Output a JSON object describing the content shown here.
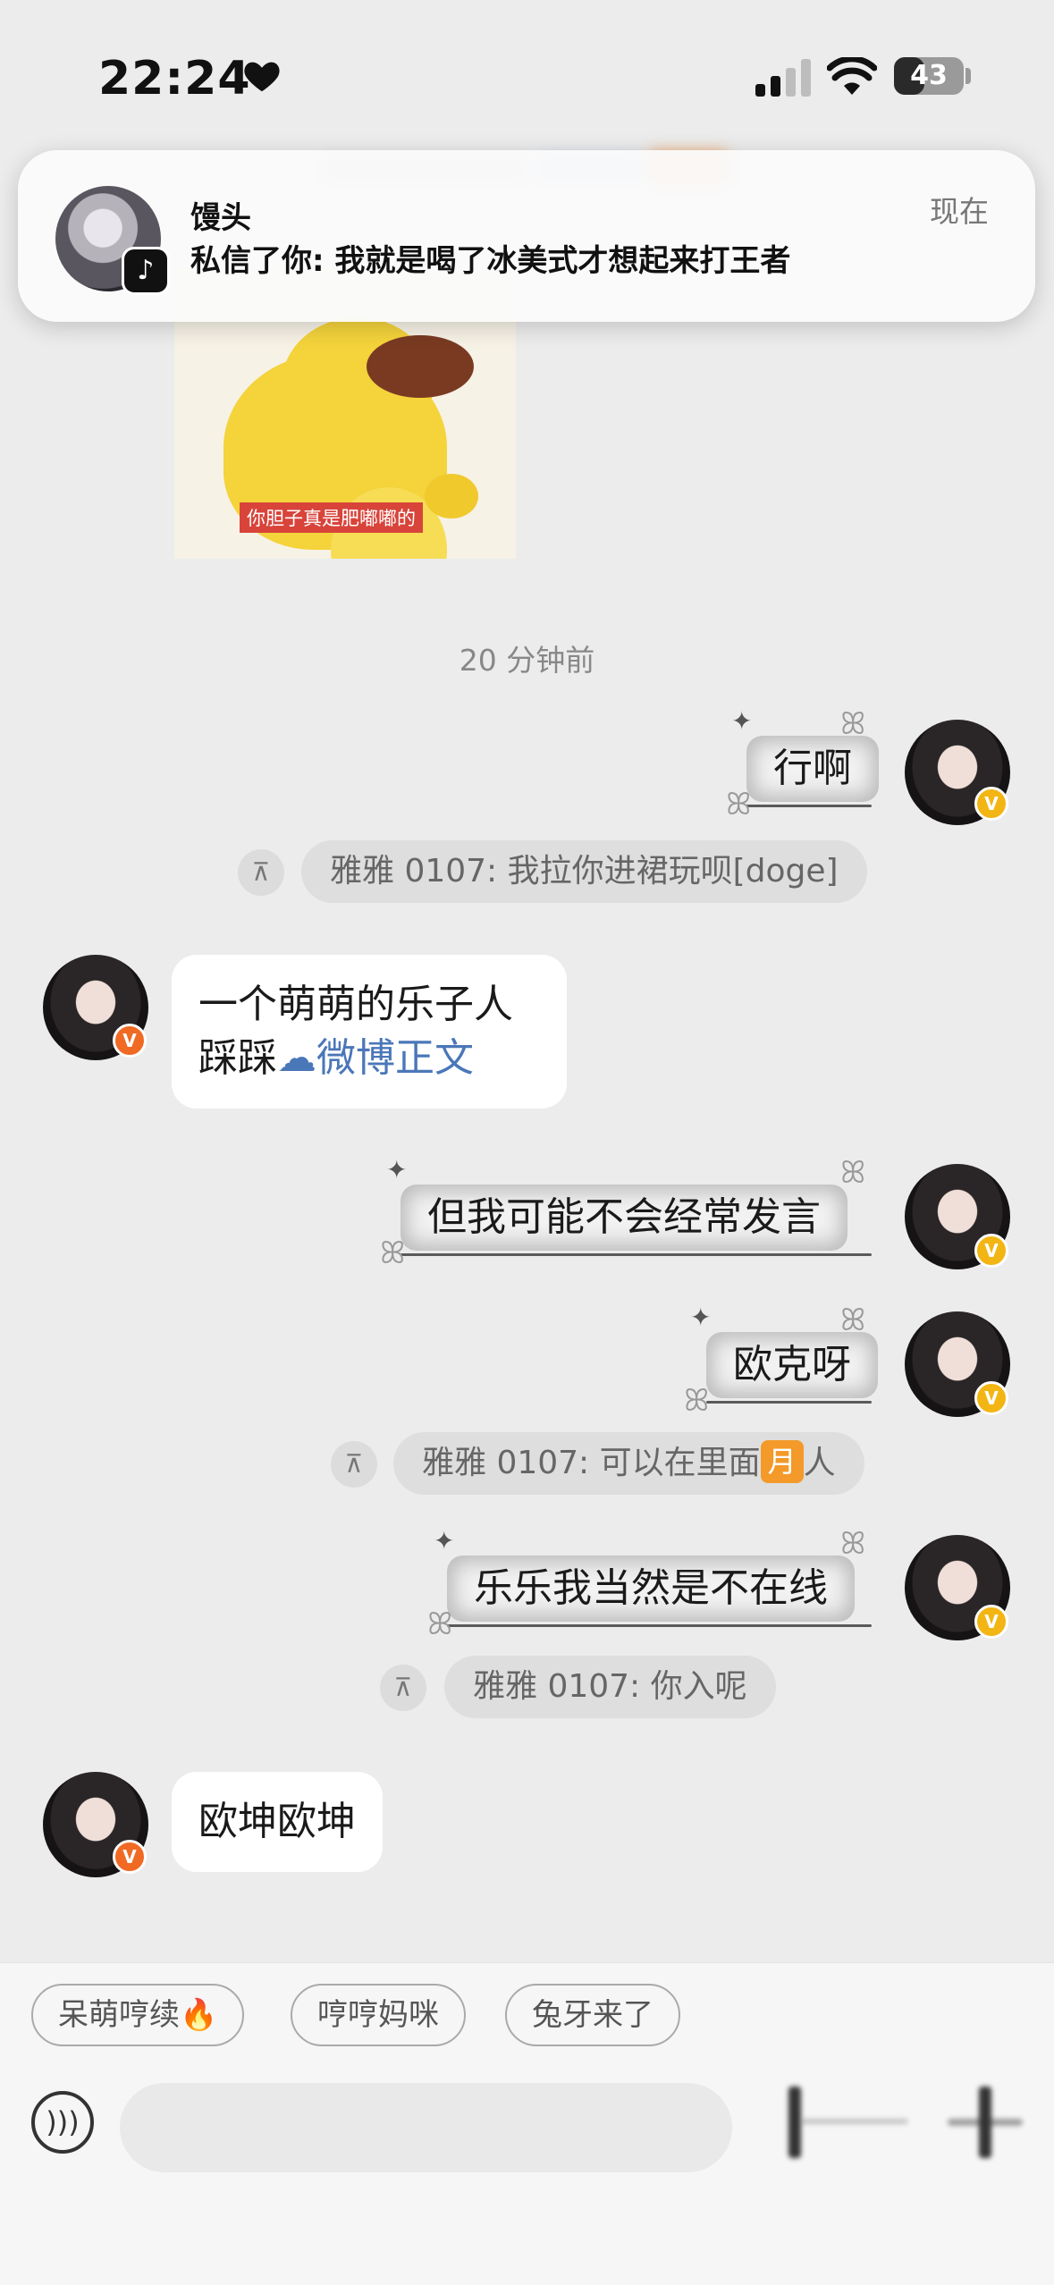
{
  "status_bar": {
    "time": "22:24",
    "battery": "43",
    "battery_level": 0.43,
    "icons": [
      "heart-icon",
      "signal-icon",
      "wifi-icon",
      "battery-icon"
    ]
  },
  "notification": {
    "sender": "馒头",
    "message": "私信了你: 我就是喝了冰美式才想起来打王者",
    "time": "现在",
    "app_icon": "tiktok-icon"
  },
  "sticker": {
    "caption": "你胆子真是肥嘟嘟的"
  },
  "timestamp": "20 分钟前",
  "messages": {
    "m1": "行啊",
    "q1": "雅雅 0107: 我拉你进裙玩呗[doge]",
    "in1_line1": "一个萌萌的乐子人",
    "in1_prefix": "踩踩",
    "in1_link": "微博正文",
    "m2": "但我可能不会经常发言",
    "m3": "欧克呀",
    "q2_prefix": "雅雅 0107: 可以在里面",
    "q2_emoji": "月",
    "q2_suffix": "人",
    "m4": "乐乐我当然是不在线",
    "q3": "雅雅 0107: 你入呢",
    "in2": "欧坤欧坤"
  },
  "quick_replies": [
    "呆萌哼续🔥",
    "哼哼妈咪",
    "兔牙来了"
  ],
  "colors": {
    "link": "#4a77b8",
    "verified_yellow": "#f3b513",
    "verified_orange": "#f06a24",
    "background": "#ececec"
  }
}
